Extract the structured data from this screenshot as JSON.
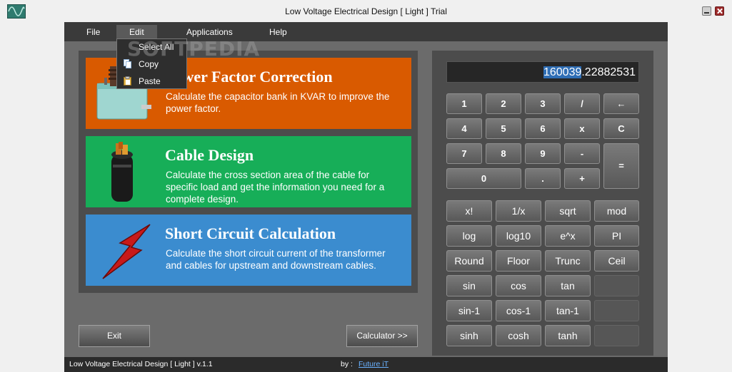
{
  "window": {
    "title": "Low Voltage Electrical Design [ Light ] Trial"
  },
  "menu": {
    "items": [
      "File",
      "Edit",
      "Applications",
      "Help"
    ],
    "active": "Edit"
  },
  "edit_menu": {
    "items": [
      "Select All",
      "Copy",
      "Paste"
    ]
  },
  "watermark": "SOFTPEDIA",
  "cards": [
    {
      "title": "Power Factor Correction",
      "description": "Calculate the capacitor bank in KVAR to improve the power factor.",
      "color": "#d95a00",
      "icon": "capacitor-icon"
    },
    {
      "title": "Cable Design",
      "description": "Calculate the cross section area of the cable for specific load and get the information you need for a complete design.",
      "color": "#17ae58",
      "icon": "cable-icon"
    },
    {
      "title": "Short Circuit Calculation",
      "description": "Calculate the short circuit current of the transformer and cables for upstream and downstream cables.",
      "color": "#3b8ccf",
      "icon": "lightning-icon"
    }
  ],
  "buttons": {
    "exit": "Exit",
    "calculator": "Calculator  >>"
  },
  "calculator": {
    "display_selected": "160039",
    "display_rest": ".22882531",
    "keypad": {
      "row1": [
        "1",
        "2",
        "3",
        "/",
        "←"
      ],
      "row2": [
        "4",
        "5",
        "6",
        "x",
        "C"
      ],
      "row3": [
        "7",
        "8",
        "9",
        "-"
      ],
      "row4": [
        "0",
        ".",
        "+"
      ],
      "equals": "="
    },
    "functions": {
      "row1": [
        "x!",
        "1/x",
        "sqrt",
        "mod"
      ],
      "row2": [
        "log",
        "log10",
        "e^x",
        "PI"
      ],
      "row3": [
        "Round",
        "Floor",
        "Trunc",
        "Ceil"
      ],
      "row4": [
        "sin",
        "cos",
        "tan"
      ],
      "row5": [
        "sin-1",
        "cos-1",
        "tan-1"
      ],
      "row6": [
        "sinh",
        "cosh",
        "tanh"
      ]
    }
  },
  "status": {
    "app": "Low Voltage Electrical Design [ Light ]  v.1.1",
    "by": "by :",
    "author": "Future iT"
  }
}
